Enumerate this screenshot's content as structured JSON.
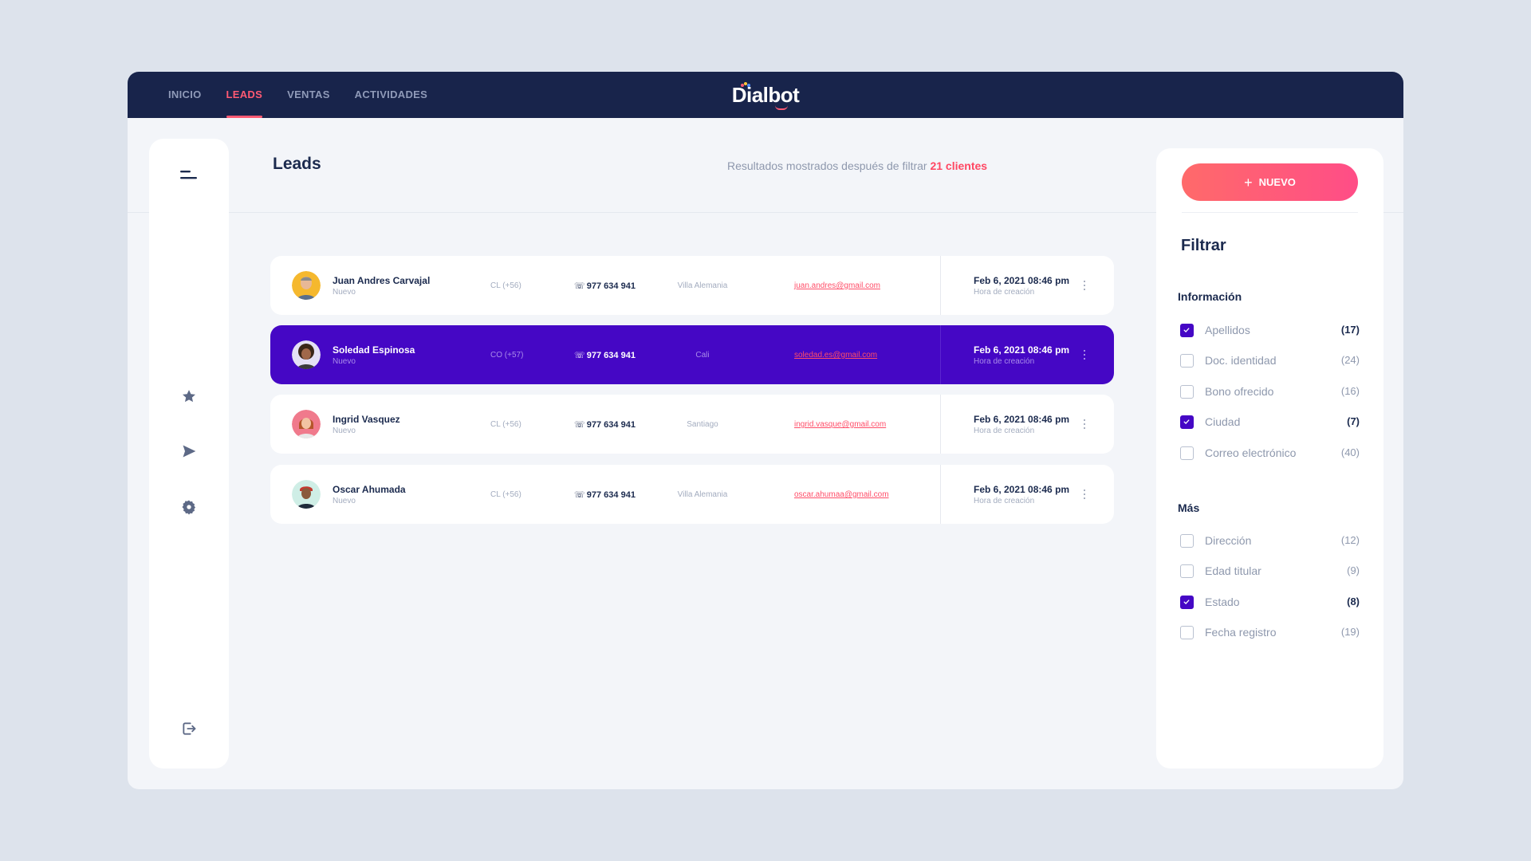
{
  "nav": {
    "items": [
      {
        "label": "INICIO",
        "active": false
      },
      {
        "label": "LEADS",
        "active": true
      },
      {
        "label": "VENTAS",
        "active": false
      },
      {
        "label": "ACTIVIDADES",
        "active": false
      }
    ],
    "logo": "Dialbot"
  },
  "sidebar": {
    "icons": [
      "menu-icon",
      "star-icon",
      "send-icon",
      "settings-icon",
      "logout-icon"
    ]
  },
  "header": {
    "title": "Leads",
    "results_text": "Resultados mostrados después de filtrar",
    "results_count": "21 clientes"
  },
  "leads": [
    {
      "name": "Juan Andres Carvajal",
      "status": "Nuevo",
      "code": "CL (+56)",
      "phone": "977 634 941",
      "city": "Villa Alemania",
      "email": "juan.andres@gmail.com",
      "date": "Feb 6, 2021 08:46 pm",
      "date_label": "Hora  de creación",
      "selected": false
    },
    {
      "name": "Soledad Espinosa",
      "status": "Nuevo",
      "code": "CO (+57)",
      "phone": "977 634 941",
      "city": "Cali",
      "email": "soledad.es@gmail.com",
      "date": "Feb 6, 2021 08:46 pm",
      "date_label": "Hora  de creación",
      "selected": true
    },
    {
      "name": "Ingrid Vasquez",
      "status": "Nuevo",
      "code": "CL (+56)",
      "phone": "977 634 941",
      "city": "Santiago",
      "email": "ingrid.vasque@gmail.com",
      "date": "Feb 6, 2021 08:46 pm",
      "date_label": "Hora  de creación",
      "selected": false
    },
    {
      "name": "Oscar Ahumada",
      "status": "Nuevo",
      "code": "CL (+56)",
      "phone": "977 634 941",
      "city": "Villa Alemania",
      "email": "oscar.ahumaa@gmail.com",
      "date": "Feb 6, 2021 08:46 pm",
      "date_label": "Hora  de creación",
      "selected": false
    }
  ],
  "filter": {
    "new_button": "NUEVO",
    "title": "Filtrar",
    "info_section": "Información",
    "info_items": [
      {
        "label": "Apellidos",
        "count": "(17)",
        "checked": true
      },
      {
        "label": "Doc. identidad",
        "count": "(24)",
        "checked": false
      },
      {
        "label": "Bono ofrecido",
        "count": "(16)",
        "checked": false
      },
      {
        "label": "Ciudad",
        "count": "(7)",
        "checked": true
      },
      {
        "label": "Correo electrónico",
        "count": "(40)",
        "checked": false
      }
    ],
    "more_section": "Más",
    "more_items": [
      {
        "label": "Dirección",
        "count": "(12)",
        "checked": false
      },
      {
        "label": "Edad titular",
        "count": "(9)",
        "checked": false
      },
      {
        "label": "Estado",
        "count": "(8)",
        "checked": true
      },
      {
        "label": "Fecha registro",
        "count": "(19)",
        "checked": false
      }
    ]
  },
  "colors": {
    "navy": "#18244b",
    "accent": "#ff5a73",
    "selected": "#4507c5",
    "background": "#dde3ec"
  }
}
